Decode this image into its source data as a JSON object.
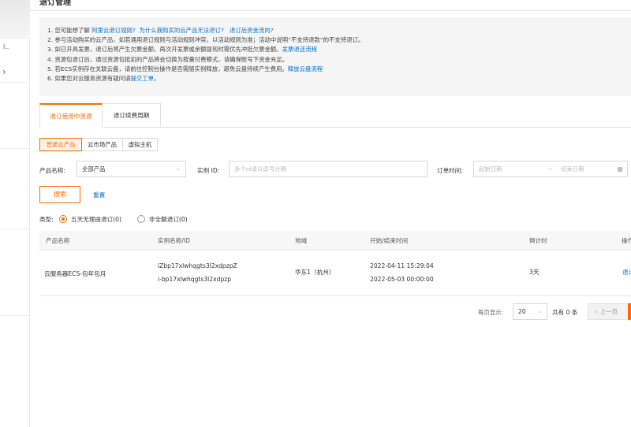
{
  "page": {
    "title": "退订管理",
    "sidebar_fragment": "l..",
    "notices": [
      {
        "text": "1. 您可能想了解 ",
        "links": [
          "阿里云退订规则?",
          "为什么我购买的云产品无法退订?",
          "退订后资金流向?"
        ]
      },
      {
        "text": "2. 参与活动购买的云产品，如若通用退订规则与活动规则冲突，以活动规则为准；活动中说明“不支持退款”的不支持退订。"
      },
      {
        "text": "3. 如已开具发票，退订后将产生欠票金额，再次开发票或余额提现时需优先冲抵欠票金额。",
        "link": "发票退还流程"
      },
      {
        "text": "4. 资源包退订后，通过资源包抵扣的产品将会切换为按量付费模式，请确保账号下资金充足。"
      },
      {
        "text": "5. 若ECS实例存在关联云盘，请前往控制台操作是否需随实例释放，避免云盘持续产生费用。",
        "link": "释放云盘流程"
      },
      {
        "text": "6. 如果您对云服务资源有疑问请",
        "link": "提交工单。"
      }
    ]
  },
  "tabs": [
    "退订使用中资源",
    "退订续费周期"
  ],
  "subtabs": [
    "普通云产品",
    "云市场产品",
    "虚拟主机"
  ],
  "filters": {
    "product_label": "产品名称:",
    "product_value": "全部产品",
    "instance_label": "实例 ID:",
    "instance_placeholder": "多个id请以逗号分隔",
    "order_time_label": "订单时间:",
    "start_placeholder": "起始日期",
    "range_sep": "~",
    "end_placeholder": "结束日期"
  },
  "buttons": {
    "search": "搜索",
    "reset": "重置"
  },
  "type_filter": {
    "label": "类型:",
    "options": [
      "五天无理由退订(0)",
      "非全额退订(0)"
    ]
  },
  "table": {
    "headers": [
      "产品名称",
      "实例名称/ID",
      "地域",
      "开始/结束时间",
      "倒计时",
      "操作"
    ],
    "rows": [
      {
        "product": "云服务器ECS-包年包月",
        "instance_name": "iZbp17xlwhqgts3l2xdpzpZ",
        "instance_id": "i-bp17xlwhqgts3l2xdpzp",
        "region": "华东1（杭州）",
        "start": "2022-04-11 15:29:04",
        "end": "2022-05-03 00:00:00",
        "countdown": "3天",
        "action": "退订"
      }
    ]
  },
  "pagination": {
    "per_page_label": "每页显示:",
    "page_size": "20",
    "total": "共有 0 条",
    "prev": "‹ 上一页"
  },
  "colors": {
    "accent": "#ff6a00",
    "link": "#0070cc"
  }
}
